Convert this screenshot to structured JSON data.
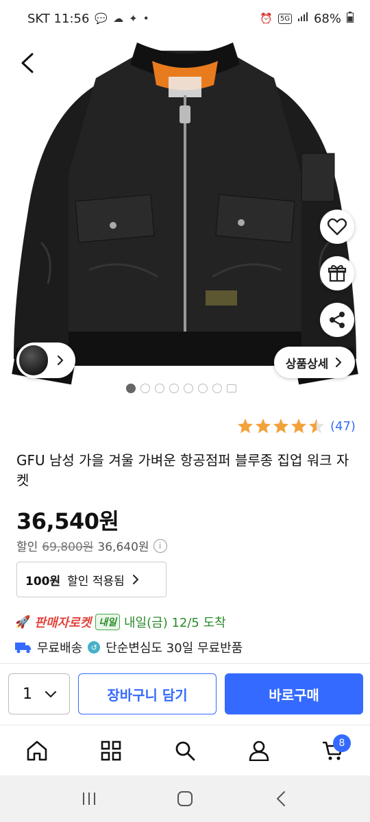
{
  "status_bar": {
    "carrier_time": "SKT 11:56",
    "network_badge": "5G",
    "battery": "68%"
  },
  "hero": {
    "detail_button_label": "상품상세",
    "dots_total": 7,
    "dots_active": 1
  },
  "product": {
    "rating_count": "(47)",
    "rating_value": 4.5,
    "title": "GFU 남성 가을 겨울 가벼운 항공점퍼 블루종 집업 워크 자켓",
    "price": "36,540원",
    "discount_label": "할인",
    "original_price": "69,800원",
    "sale_price_before_coupon": "36,640원",
    "info_symbol": "i",
    "coupon_amount": "100원",
    "coupon_text": "할인 적용됨"
  },
  "delivery": {
    "rocket_label": "판매자로켓",
    "tomorrow_badge": "내일",
    "arrival_text": "내일(금) 12/5 도착"
  },
  "benefits": {
    "free_shipping": "무료배송",
    "free_return": "단순변심도 30일 무료반품"
  },
  "purchase": {
    "quantity": "1",
    "cart_button": "장바구니 담기",
    "buy_button": "바로구매"
  },
  "bottom_nav": {
    "cart_count": "8"
  },
  "colors": {
    "accent": "#346aff",
    "rocket_red": "#e3443d",
    "arrival_green": "#2a8a2a",
    "star": "#f2a23b"
  }
}
